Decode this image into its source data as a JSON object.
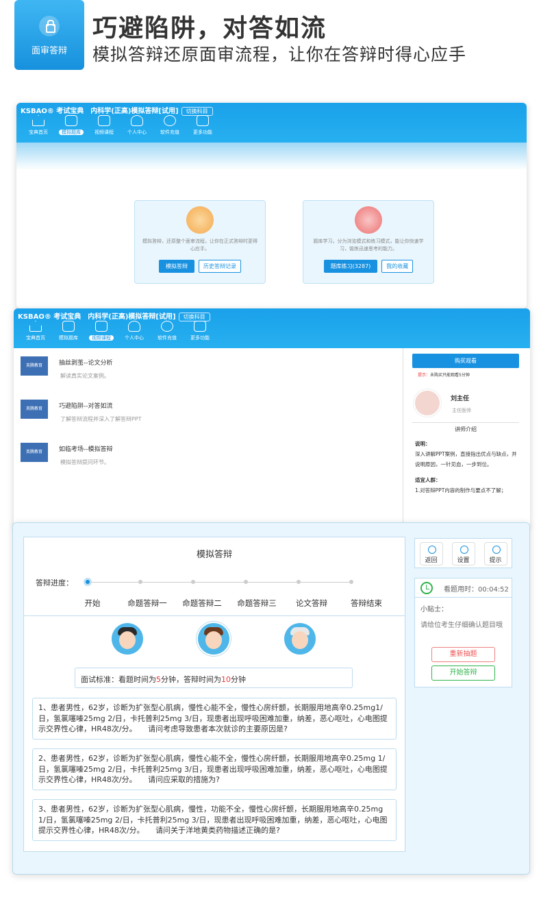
{
  "header": {
    "badge_label": "面审答辩",
    "title": "巧避陷阱，对答如流",
    "subtitle": "模拟答辩还原面审流程，让你在答辩时得心应手"
  },
  "app": {
    "brand": "KSBAO® 考试宝典",
    "course_title": "内科学(正高)模拟答辩[试用]",
    "switch_subject": "切换科目",
    "nav": [
      {
        "label": "宝典首页",
        "icon": "home-icon"
      },
      {
        "label": "模拟题库",
        "icon": "film-icon"
      },
      {
        "label": "视频课程",
        "icon": "play-icon"
      },
      {
        "label": "个人中心",
        "icon": "user-icon"
      },
      {
        "label": "软件充值",
        "icon": "bag-icon"
      },
      {
        "label": "更多功能",
        "icon": "grid-icon"
      }
    ]
  },
  "screen1": {
    "card_left": {
      "desc": "模拟答辩，还原整个面审流程，让你在正式答辩时更得心应手。",
      "primary": "模拟答辩",
      "secondary": "历史答辩记录"
    },
    "card_right": {
      "desc": "题库学习，分为浏览模式和练习模式，能让你快速学习，锻炼迅速思考的能力。",
      "primary": "题库练习(3287)",
      "secondary": "我的收藏"
    }
  },
  "screen2": {
    "courses": [
      {
        "title": "抽丝剥茧--论文分析",
        "sub": "解读真实论文案例。"
      },
      {
        "title": "巧避陷阱--对答如流",
        "sub": "了解答辩流程并深入了解答辩PPT"
      },
      {
        "title": "如临考场--模拟答辩",
        "sub": "模拟答辩提问环节。"
      }
    ],
    "thumb_label": "英腾教育",
    "buy": "购买观看",
    "tip_label": "提示：",
    "tip_text": "未购买只能观看5分钟",
    "teacher_name": "刘主任",
    "teacher_pos": "主任医师",
    "teacher_intro": "讲师介绍",
    "note_label": "说明：",
    "note_text": "深入讲解PPT案例，直接指出优点与缺点，并说明原因，一针见血，一步到位。",
    "crowd_label": "适宜人群：",
    "crowd_text": "1.对答辩PPT内容的制作与要点不了解；"
  },
  "screen3": {
    "title": "模拟答辩",
    "progress_label": "答辩进度：",
    "steps": [
      "开始",
      "命题答辩一",
      "命题答辩二",
      "命题答辩三",
      "论文答辩",
      "答辩结束"
    ],
    "standard_pre": "面试标准：看题时间为",
    "standard_n1": "5",
    "standard_mid": "分钟，答辩时间为",
    "standard_n2": "10",
    "standard_post": "分钟",
    "questions": [
      "1、患者男性，62岁，诊断为扩张型心肌病，慢性心能不全，慢性心房纤颤，长期服用地高辛0.25mg1/日，氢氯噻嗪25mg 2/日，卡托普利25mg 3/日，现患者出现呼吸困难加重，纳差，恶心呕吐，心电图提示交界性心律，HR48次/分。　　请问考虑导致患者本次就诊的主要原因是?",
      "2、患者男性，62岁，诊断为扩张型心肌病，慢性心能不全，慢性心房纤颤，长期服用地高辛0.25mg 1/日，氢氯噻嗪25mg 2/日，卡托普利25mg 3/日，现患者出现呼吸困难加重，纳差，恶心呕吐，心电图提示交界性心律，HR48次/分。　　请问应采取的措施为?",
      "3、患者男性，62岁，诊断为扩张型心肌病，慢性，功能不全，慢性心房纤颤，长期服用地高辛0.25mg 1/日，氢氯噻嗪25mg 2/日，卡托普利25mg 3/日，现患者出现呼吸困难加重，纳差，恶心呕吐，心电图提示交界性心律，HR48次/分。　　请问关于洋地黄类药物描述正确的是?"
    ],
    "tools": [
      "返回",
      "设置",
      "提示"
    ],
    "timer": "看题用时：00:04:52",
    "tip_title": "小贴士：",
    "tip_body": "请给位考生仔细确认题目哦",
    "redraw": "重新抽题",
    "start": "开始答辩"
  }
}
